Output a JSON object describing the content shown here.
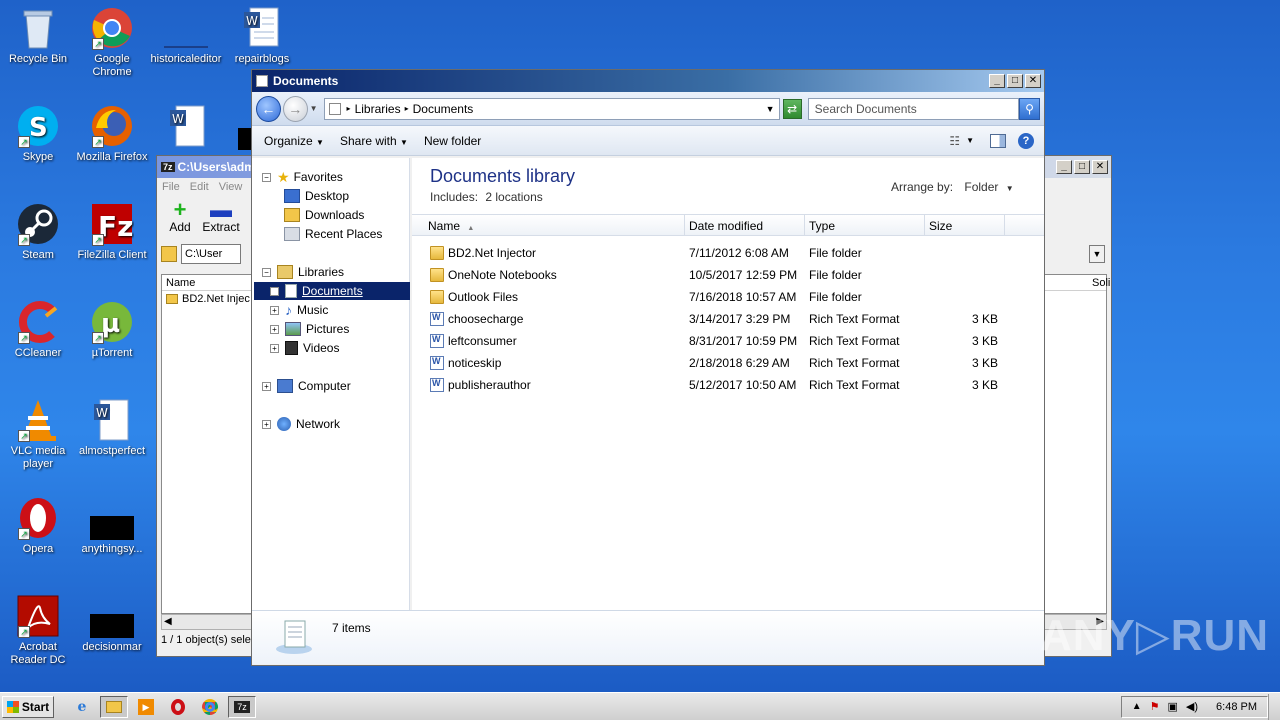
{
  "desktop": {
    "icons": [
      {
        "label": "Recycle Bin"
      },
      {
        "label": "Google\nChrome"
      },
      {
        "label": "historicaleditor"
      },
      {
        "label": "repairblogs"
      },
      {
        "label": "Skype"
      },
      {
        "label": "Mozilla Firefox"
      },
      {
        "label": "Steam"
      },
      {
        "label": "FileZilla Client"
      },
      {
        "label": "CCleaner"
      },
      {
        "label": "µTorrent"
      },
      {
        "label": "VLC media player"
      },
      {
        "label": "almostperfect"
      },
      {
        "label": "Opera"
      },
      {
        "label": "anythingsy..."
      },
      {
        "label": "Acrobat Reader DC"
      },
      {
        "label": "decisionmar"
      }
    ]
  },
  "sevenzip": {
    "title": "C:\\Users\\adm",
    "menu": [
      "File",
      "Edit",
      "View"
    ],
    "add_label": "Add",
    "extract_label": "Extract",
    "path": "C:\\User",
    "col_name": "Name",
    "col_right": "Soli",
    "row_name": "BD2.Net Injec",
    "status": "1 / 1 object(s) sele"
  },
  "explorer": {
    "title": "Documents",
    "breadcrumb": [
      "Libraries",
      "Documents"
    ],
    "search_placeholder": "Search Documents",
    "commands": {
      "organize": "Organize",
      "share": "Share with",
      "new_folder": "New folder"
    },
    "nav": {
      "favorites": "Favorites",
      "desktop": "Desktop",
      "downloads": "Downloads",
      "recent": "Recent Places",
      "libraries": "Libraries",
      "documents": "Documents",
      "music": "Music",
      "pictures": "Pictures",
      "videos": "Videos",
      "computer": "Computer",
      "network": "Network"
    },
    "library_title": "Documents library",
    "includes_label": "Includes:",
    "includes_link": "2 locations",
    "arrange_label": "Arrange by:",
    "arrange_value": "Folder",
    "columns": {
      "name": "Name",
      "date": "Date modified",
      "type": "Type",
      "size": "Size"
    },
    "files": [
      {
        "name": "BD2.Net Injector",
        "date": "7/11/2012 6:08 AM",
        "type": "File folder",
        "size": "",
        "kind": "folder"
      },
      {
        "name": "OneNote Notebooks",
        "date": "10/5/2017 12:59 PM",
        "type": "File folder",
        "size": "",
        "kind": "folder"
      },
      {
        "name": "Outlook Files",
        "date": "7/16/2018 10:57 AM",
        "type": "File folder",
        "size": "",
        "kind": "folder"
      },
      {
        "name": "choosecharge",
        "date": "3/14/2017 3:29 PM",
        "type": "Rich Text Format",
        "size": "3 KB",
        "kind": "doc"
      },
      {
        "name": "leftconsumer",
        "date": "8/31/2017 10:59 PM",
        "type": "Rich Text Format",
        "size": "3 KB",
        "kind": "doc"
      },
      {
        "name": "noticeskip",
        "date": "2/18/2018 6:29 AM",
        "type": "Rich Text Format",
        "size": "3 KB",
        "kind": "doc"
      },
      {
        "name": "publisherauthor",
        "date": "5/12/2017 10:50 AM",
        "type": "Rich Text Format",
        "size": "3 KB",
        "kind": "doc"
      }
    ],
    "item_count": "7 items"
  },
  "taskbar": {
    "start_label": "Start",
    "clock": "6:48 PM"
  },
  "watermark": "ANY▷RUN"
}
